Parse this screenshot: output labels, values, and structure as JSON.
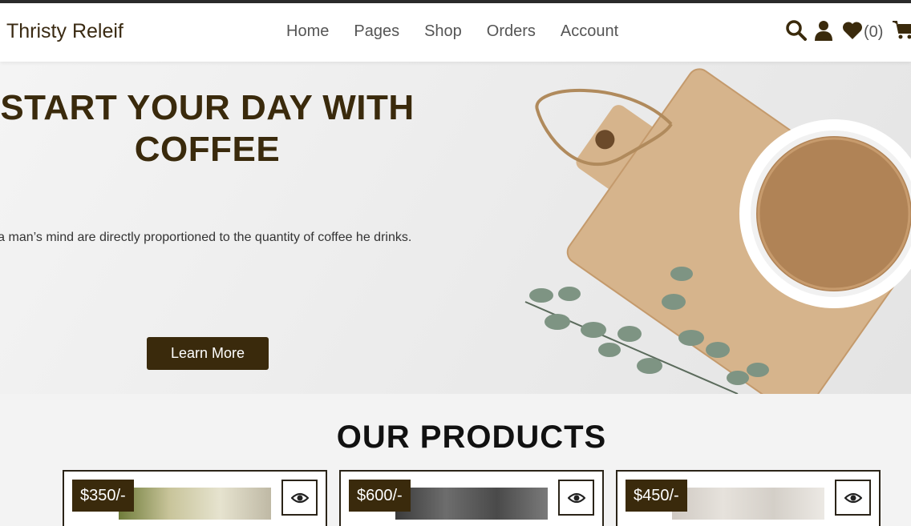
{
  "header": {
    "logo": "Thristy Releif",
    "nav": [
      "Home",
      "Pages",
      "Shop",
      "Orders",
      "Account"
    ],
    "wishlist_count": "(0)"
  },
  "hero": {
    "title_line1": "START YOUR DAY WITH",
    "title_line2": "COFFEE",
    "text": "vers of a man’s mind are directly proportioned to the quantity of coffee he drinks.",
    "button": "Learn More"
  },
  "products": {
    "title": "OUR PRODUCTS",
    "items": [
      {
        "price": "$350/-"
      },
      {
        "price": "$600/-"
      },
      {
        "price": "$450/-"
      }
    ]
  },
  "icons": {
    "search": "search-icon",
    "user": "user-icon",
    "heart": "heart-icon",
    "cart": "cart-icon",
    "eye": "eye-icon"
  },
  "colors": {
    "brand_dark": "#3a2a0c",
    "nav_text": "#555555",
    "background": "#f3f3f3"
  }
}
